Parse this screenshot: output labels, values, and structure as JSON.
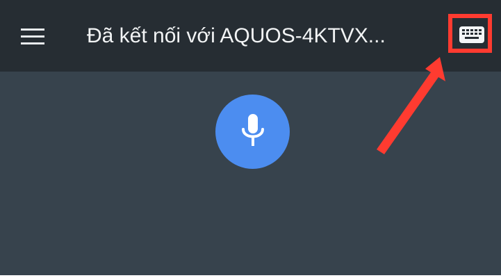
{
  "header": {
    "title": "Đã kết nối với AQUOS-4KTVX...",
    "menu_icon": "menu-icon",
    "keyboard_icon": "keyboard-icon"
  },
  "voice": {
    "mic_icon": "microphone-icon"
  },
  "annotation": {
    "highlight_color": "#ff3b30"
  },
  "colors": {
    "topbar": "#262d33",
    "background": "#37434d",
    "accent": "#4c8df0",
    "text": "#f2f4f5"
  }
}
